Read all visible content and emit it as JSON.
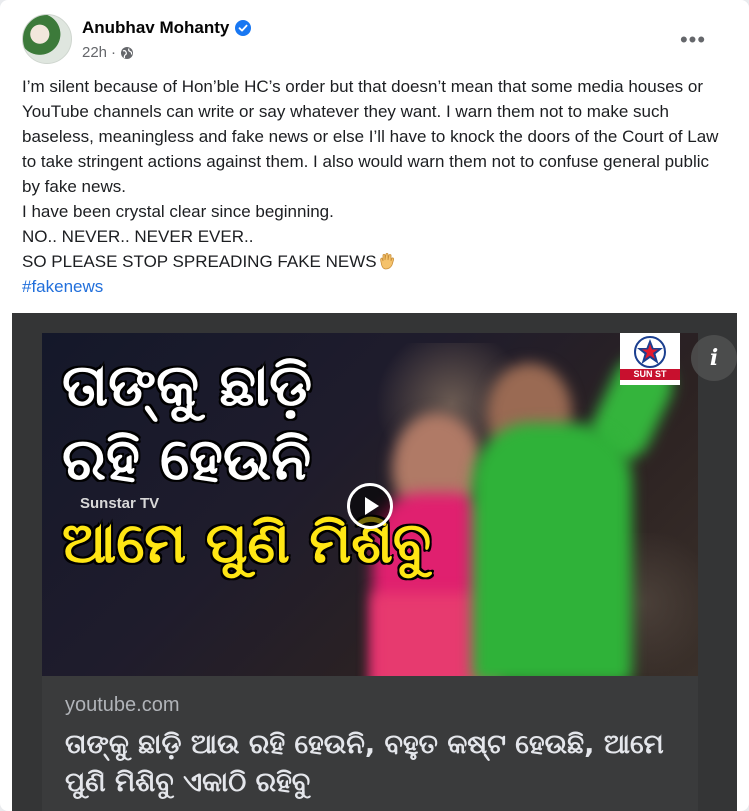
{
  "post": {
    "author": "Anubhav Mohanty",
    "time": "22h",
    "time_separator": "·",
    "more_label": "•••",
    "text_lines": [
      "I’m silent because of Hon’ble HC’s order but that doesn’t mean that some media houses or YouTube channels can write or say whatever they want. I warn them not to make such baseless, meaningless and fake news or else I’ll have to knock the doors of the Court of Law to take stringent actions against them. I also would warn them not to confuse general public by fake news.",
      "I have been crystal clear since beginning.",
      "NO.. NEVER.. NEVER EVER..",
      "SO PLEASE STOP SPREADING FAKE NEWS"
    ],
    "hashtag": "#fakenews"
  },
  "link_preview": {
    "thumbnail": {
      "line1": "ତାଙ୍କୁ ଛାଡ଼ି",
      "line2": "ରହି ହେଉନି",
      "line3": "ଆମେ ପୁଣି ମିଶିବୁ",
      "channel": "Sunstar TV",
      "logo_text": "SUN ST"
    },
    "info_label": "i",
    "domain": "youtube.com",
    "title": "ତାଙ୍କୁ ଛାଡ଼ି ଆଉ ରହି ହେଉନି, ବହୁତ କଷ୍ଟ ହେଉଛି, ଆମେ ପୁଣି ମିଶିବୁ ଏକାଠି ରହିବୁ"
  },
  "colors": {
    "verified": "#1877f2",
    "hashtag": "#216fdb",
    "card_bg": "#3a3b3c",
    "highlight_yellow": "#ffe614"
  },
  "icons": [
    "verified-icon",
    "globe-icon",
    "more-icon",
    "raised-hand-icon",
    "play-icon",
    "info-icon",
    "star-logo-icon"
  ]
}
